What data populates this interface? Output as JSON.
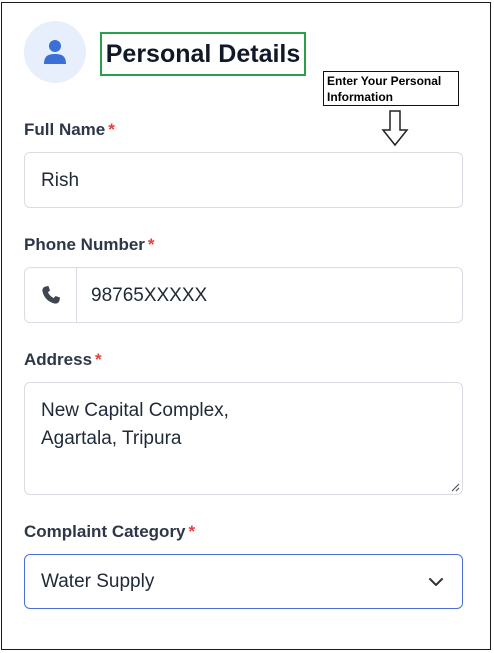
{
  "header": {
    "title": "Personal Details",
    "avatar_icon": "user-icon",
    "accent_color": "#3b6fd8"
  },
  "callout": {
    "text": "Enter Your Personal\nInformation",
    "arrow_icon": "arrow-down-outline-icon"
  },
  "form": {
    "required_mark": "*",
    "full_name": {
      "label": "Full Name",
      "value": "Rish"
    },
    "phone": {
      "label": "Phone Number",
      "value": "98765XXXXX",
      "icon": "phone-icon"
    },
    "address": {
      "label": "Address",
      "value": "New Capital Complex,\nAgartala, Tripura"
    },
    "category": {
      "label": "Complaint Category",
      "value": "Water Supply",
      "icon": "chevron-down-icon"
    }
  },
  "colors": {
    "required": "#e53e3e",
    "title_border": "#27a047",
    "select_focus_border": "#4c6fd6"
  }
}
